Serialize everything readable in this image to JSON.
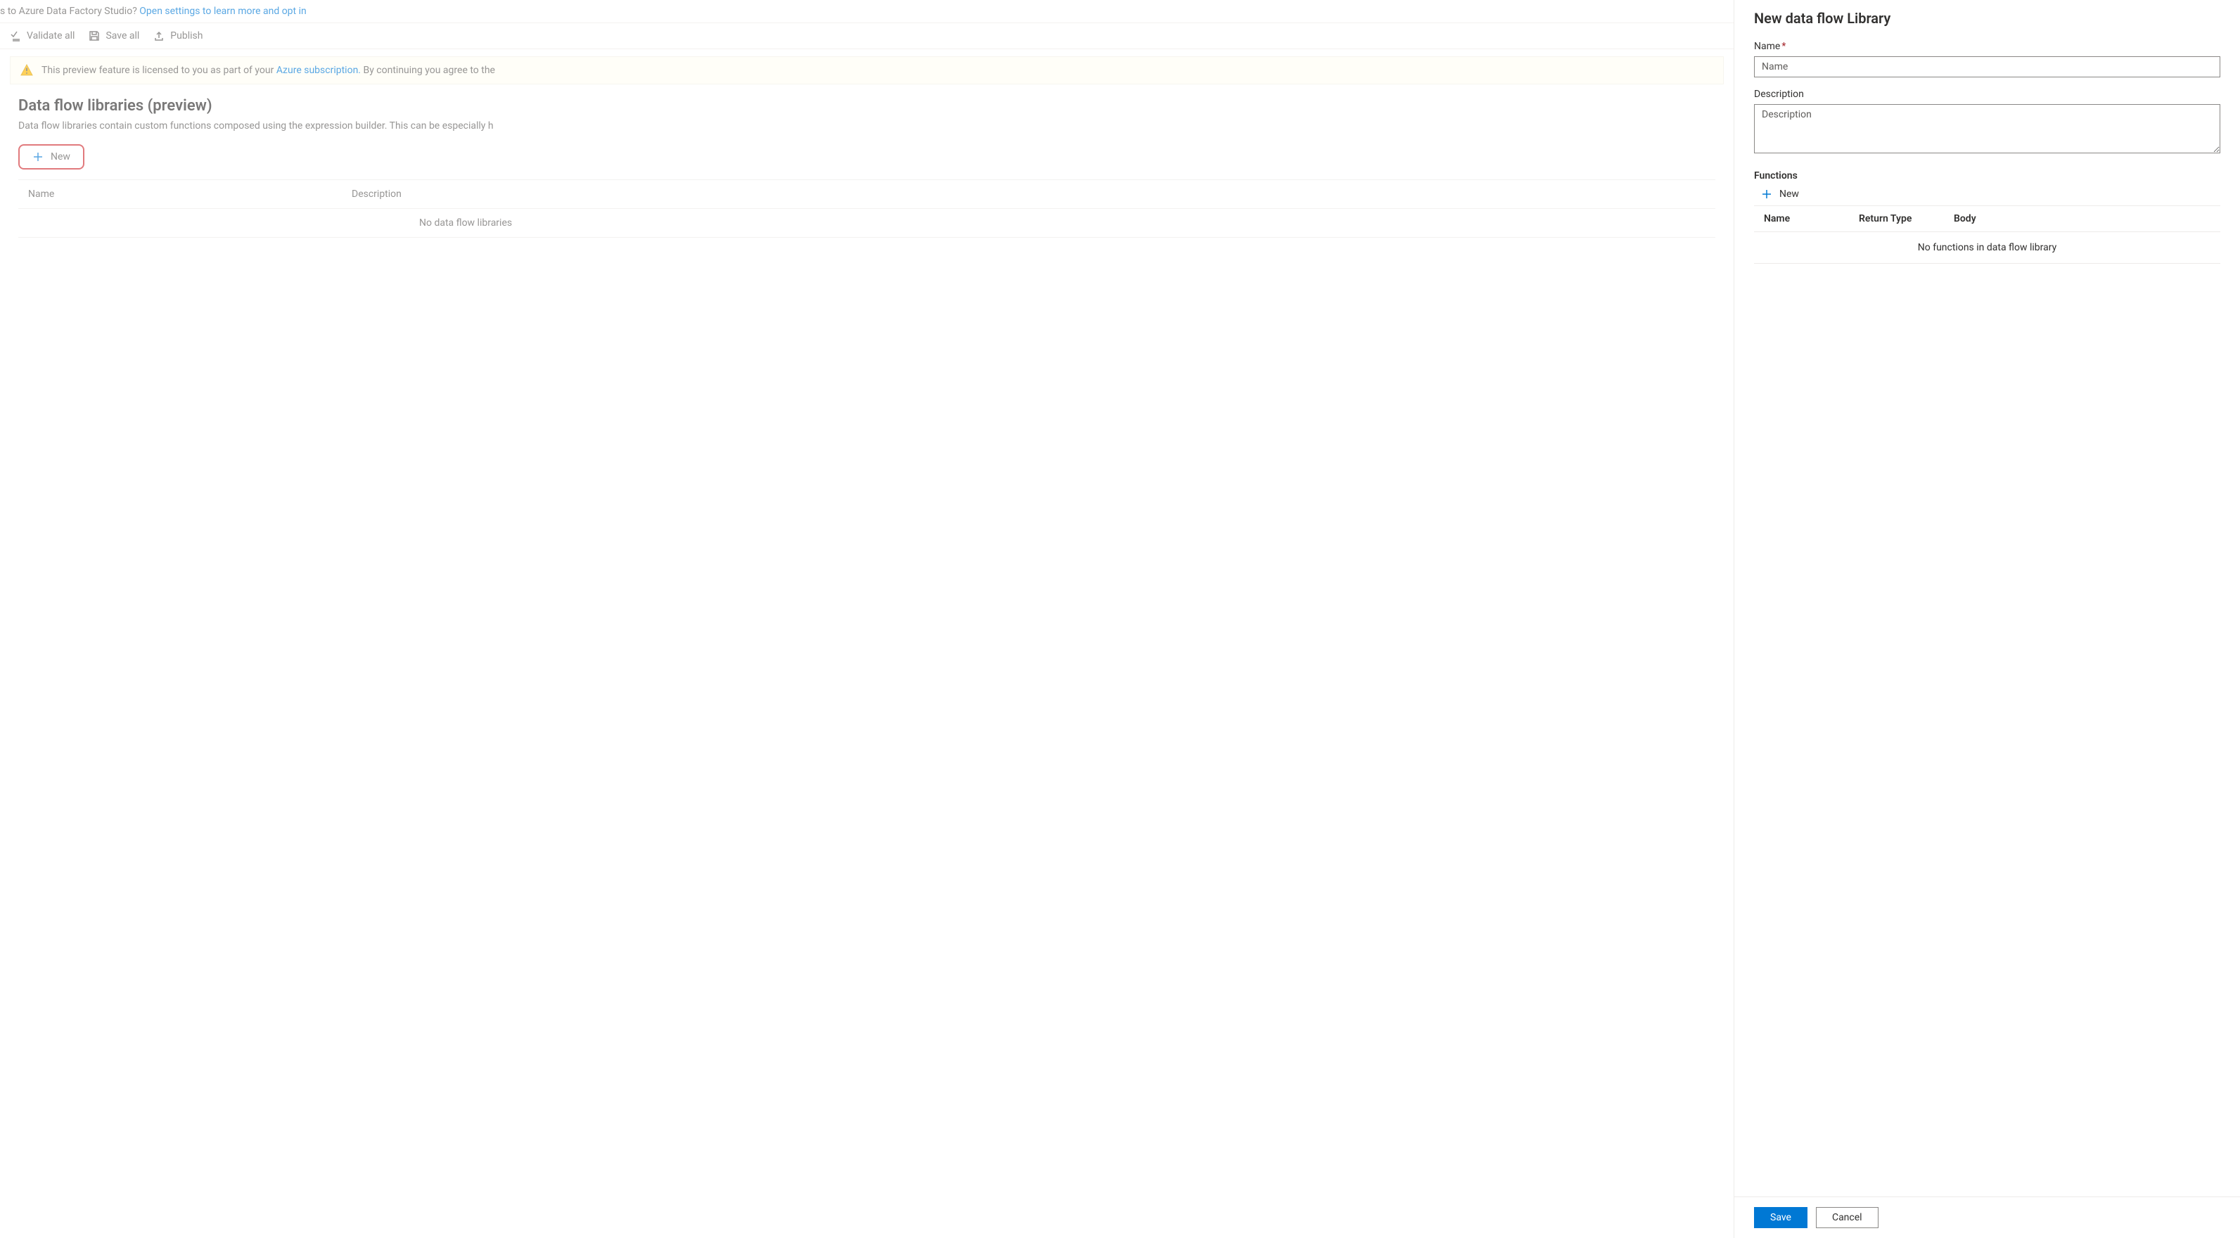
{
  "top_notification": {
    "prefix": "s to Azure Data Factory Studio? ",
    "link": "Open settings to learn more and opt in"
  },
  "toolbar": {
    "validate_all": "Validate all",
    "save_all": "Save all",
    "publish": "Publish"
  },
  "preview_banner": {
    "text_prefix": "This preview feature is licensed to you as part of your ",
    "link": "Azure subscription.",
    "text_suffix": " By continuing you agree to the"
  },
  "page": {
    "title": "Data flow libraries (preview)",
    "subtitle": "Data flow libraries contain custom functions composed using the expression builder. This can be especially h",
    "new_button": "New",
    "table": {
      "col_name": "Name",
      "col_description": "Description",
      "empty": "No data flow libraries "
    }
  },
  "panel": {
    "title": "New data flow Library",
    "name_label": "Name",
    "name_placeholder": "Name",
    "name_value": "",
    "description_label": "Description",
    "description_placeholder": "Description",
    "description_value": "",
    "functions": {
      "title": "Functions",
      "new_label": "New",
      "col_name": "Name",
      "col_return": "Return Type",
      "col_body": "Body",
      "empty": "No functions in data flow library"
    },
    "footer": {
      "save": "Save",
      "cancel": "Cancel"
    }
  }
}
